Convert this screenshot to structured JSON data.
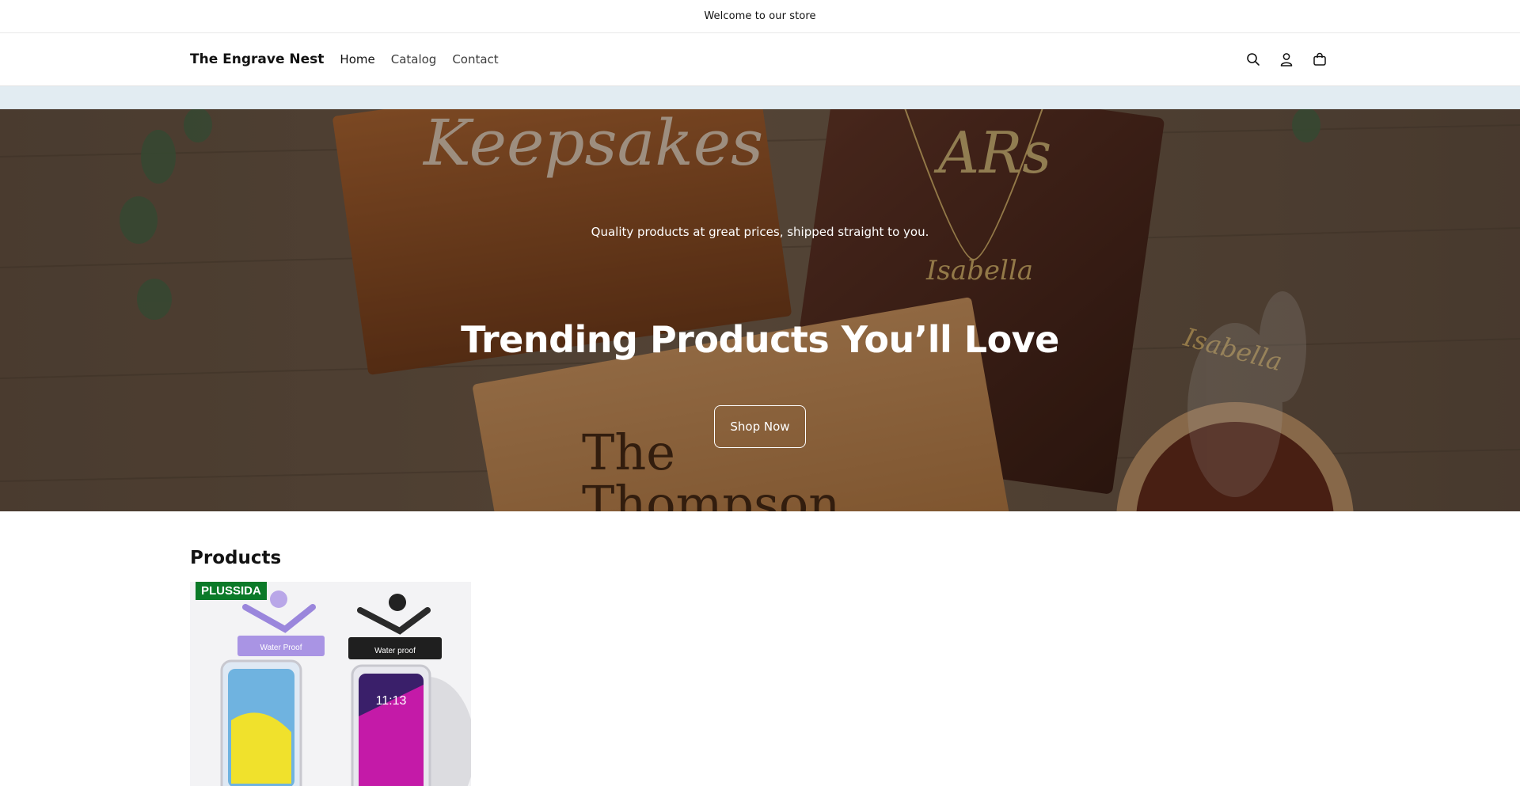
{
  "announcement": {
    "text": "Welcome to our store"
  },
  "header": {
    "logo": "The Engrave Nest",
    "nav": [
      {
        "label": "Home",
        "active": true
      },
      {
        "label": "Catalog",
        "active": false
      },
      {
        "label": "Contact",
        "active": false
      }
    ],
    "icons": [
      "search-icon",
      "account-icon",
      "cart-icon"
    ]
  },
  "hero": {
    "subtitle": "Quality products at great prices, shipped straight to you.",
    "title": "Trending Products You’ll Love",
    "button": "Shop Now",
    "image_text": {
      "box_lid": "Keepsakes",
      "book_monogram": "ARs",
      "necklace_1": "Isabella",
      "necklace_2": "Isabella",
      "plaque_line1": "The",
      "plaque_line2": "Thompson"
    }
  },
  "products": {
    "heading": "Products",
    "items": [
      {
        "badge": "PLUSSIDA",
        "label_purple": "Water Proof",
        "label_black": "Water proof",
        "phone_time": "11:13"
      }
    ]
  },
  "colors": {
    "subbar": "#e2ecf2",
    "badge": "#0b7a28",
    "hero_text": "#ffffff"
  }
}
